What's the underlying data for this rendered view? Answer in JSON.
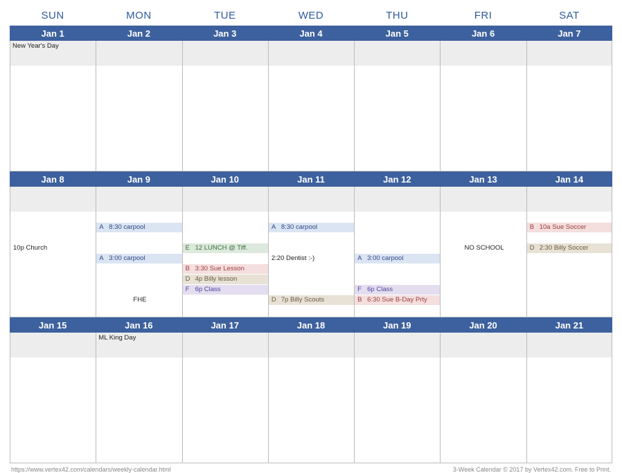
{
  "days_of_week": [
    "SUN",
    "MON",
    "TUE",
    "WED",
    "THU",
    "FRI",
    "SAT"
  ],
  "weeks": [
    {
      "dates": [
        "Jan 1",
        "Jan 2",
        "Jan 3",
        "Jan 4",
        "Jan 5",
        "Jan 6",
        "Jan 7"
      ],
      "holidays": [
        "New Year's Day",
        "",
        "",
        "",
        "",
        "",
        ""
      ],
      "events": [
        [],
        [],
        [],
        [],
        [],
        [],
        []
      ]
    },
    {
      "dates": [
        "Jan 8",
        "Jan 9",
        "Jan 10",
        "Jan 11",
        "Jan 12",
        "Jan 13",
        "Jan 14"
      ],
      "holidays": [
        "",
        "",
        "",
        "",
        "",
        "",
        ""
      ],
      "events": [
        [
          {
            "row": 3,
            "cat": "",
            "text": "10p  Church",
            "cls": "plain"
          }
        ],
        [
          {
            "row": 1,
            "cat": "A",
            "text": "8:30 carpool",
            "cls": "a"
          },
          {
            "row": 4,
            "cat": "A",
            "text": "3:00 carpool",
            "cls": "a"
          },
          {
            "row": 8,
            "cat": "",
            "text": "FHE",
            "cls": "plain",
            "center": true
          }
        ],
        [
          {
            "row": 3,
            "cat": "E",
            "text": "12 LUNCH @ Tiff.",
            "cls": "e"
          },
          {
            "row": 5,
            "cat": "B",
            "text": "3:30 Sue Lesson",
            "cls": "b"
          },
          {
            "row": 6,
            "cat": "D",
            "text": "4p Billy lesson",
            "cls": "d"
          },
          {
            "row": 7,
            "cat": "F",
            "text": "6p Class",
            "cls": "f"
          }
        ],
        [
          {
            "row": 1,
            "cat": "A",
            "text": "8:30 carpool",
            "cls": "a"
          },
          {
            "row": 4,
            "cat": "",
            "text": "2:20  Dentist :-)",
            "cls": "plain"
          },
          {
            "row": 8,
            "cat": "D",
            "text": "7p Billy Scouts",
            "cls": "d"
          }
        ],
        [
          {
            "row": 4,
            "cat": "A",
            "text": "3:00 carpool",
            "cls": "a"
          },
          {
            "row": 7,
            "cat": "F",
            "text": "6p Class",
            "cls": "f"
          },
          {
            "row": 8,
            "cat": "B",
            "text": "6:30 Sue B-Day Prty",
            "cls": "b"
          }
        ],
        [
          {
            "row": 3,
            "cat": "",
            "text": "NO SCHOOL",
            "cls": "plain",
            "center": true
          }
        ],
        [
          {
            "row": 1,
            "cat": "B",
            "text": "10a Sue Soccer",
            "cls": "b"
          },
          {
            "row": 3,
            "cat": "D",
            "text": "2:30 Billy Soccer",
            "cls": "d"
          }
        ]
      ]
    },
    {
      "dates": [
        "Jan 15",
        "Jan 16",
        "Jan 17",
        "Jan 18",
        "Jan 19",
        "Jan 20",
        "Jan 21"
      ],
      "holidays": [
        "",
        "ML King Day",
        "",
        "",
        "",
        "",
        ""
      ],
      "events": [
        [],
        [],
        [],
        [],
        [],
        [],
        []
      ]
    }
  ],
  "footer": {
    "left": "https://www.vertex42.com/calendars/weekly-calendar.html",
    "right": "3-Week Calendar © 2017 by Vertex42.com. Free to Print."
  }
}
